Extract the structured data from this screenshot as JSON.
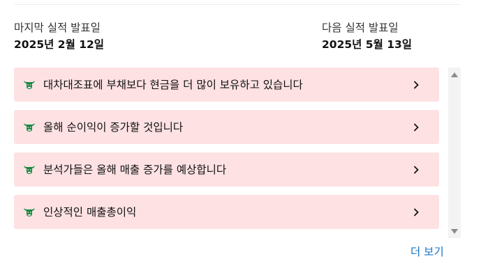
{
  "earnings": {
    "last": {
      "label": "마지막 실적 발표일",
      "date": "2025년 2월 12일"
    },
    "next": {
      "label": "다음 실적 발표일",
      "date": "2025년 5월 13일"
    }
  },
  "insights": [
    {
      "text": "대차대조표에 부채보다 현금을 더 많이 보유하고 있습니다",
      "icon": "bull-icon"
    },
    {
      "text": "올해 순이익이 증가할 것입니다",
      "icon": "bull-icon"
    },
    {
      "text": "분석가들은 올해 매출 증가를 예상합니다",
      "icon": "bull-icon"
    },
    {
      "text": "인상적인 매출총이익",
      "icon": "bull-icon"
    }
  ],
  "more": {
    "label": "더 보기"
  },
  "colors": {
    "item_bg": "#fde1e3",
    "bull": "#0e8a3e",
    "link": "#1a73c8"
  }
}
